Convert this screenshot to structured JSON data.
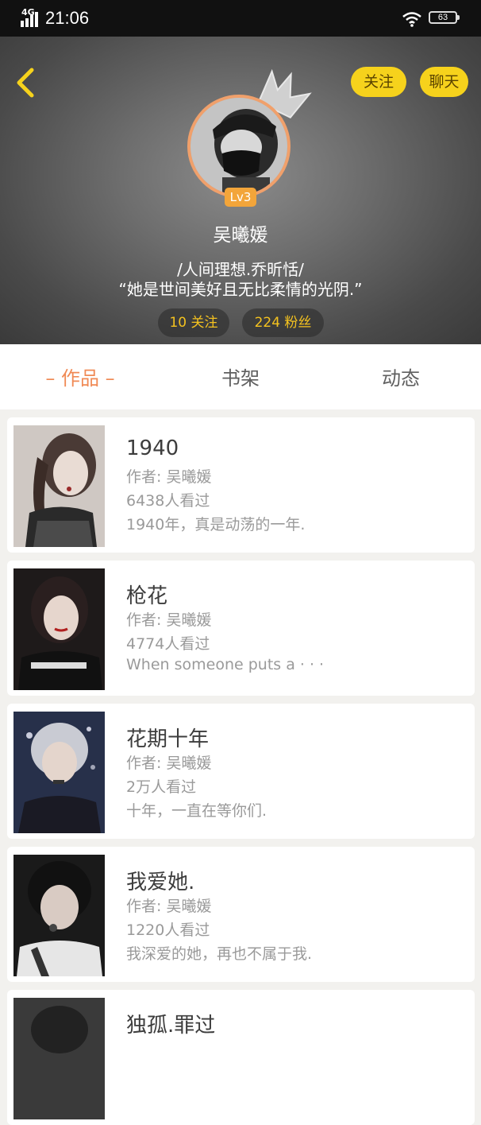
{
  "status_bar": {
    "network": "4G",
    "time": "21:06",
    "battery": "63"
  },
  "header": {
    "follow_label": "关注",
    "chat_label": "聊天",
    "level": "Lv3",
    "username": "吴曦媛",
    "motto_line1": "/人间理想.乔昕恬/",
    "motto_line2": "“她是世间美好且无比柔情的光阴.”",
    "following_stat": "10 关注",
    "fans_stat": "224 粉丝"
  },
  "tabs": [
    {
      "label": "– 作品 –",
      "active": true
    },
    {
      "label": "书架",
      "active": false
    },
    {
      "label": "动态",
      "active": false
    }
  ],
  "works": [
    {
      "title": "1940",
      "author": "作者: 吴曦媛",
      "views": "6438人看过",
      "desc": "1940年，真是动荡的一年."
    },
    {
      "title": "枪花",
      "author": "作者: 吴曦媛",
      "views": "4774人看过",
      "desc": "When someone puts a · · ·"
    },
    {
      "title": "花期十年",
      "author": "作者: 吴曦媛",
      "views": "2万人看过",
      "desc": "十年，一直在等你们."
    },
    {
      "title": "我爱她.",
      "author": "作者: 吴曦媛",
      "views": "1220人看过",
      "desc": "我深爱的她，再也不属于我."
    },
    {
      "title": "独孤.罪过",
      "author": "",
      "views": "",
      "desc": ""
    }
  ],
  "colors": {
    "accent": "#f08a55",
    "button_yellow": "#f6d21c",
    "stat_text": "#f4c21f",
    "level_badge": "#f3a53a"
  }
}
